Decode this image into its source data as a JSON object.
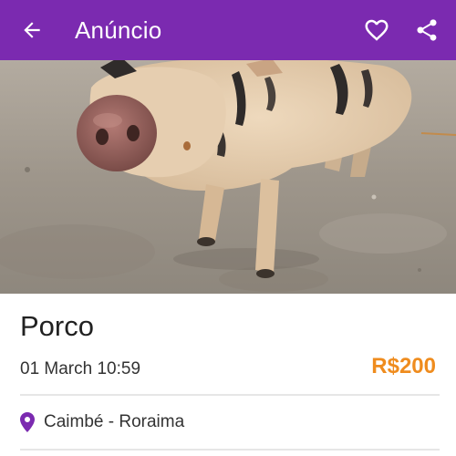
{
  "appbar": {
    "title": "Anúncio",
    "back_icon": "arrow-left-icon",
    "favorite_icon": "heart-outline-icon",
    "share_icon": "share-icon",
    "background_color": "#7b2ab0",
    "text_color": "#ffffff"
  },
  "photo": {
    "subject": "pig-photo"
  },
  "listing": {
    "title": "Porco",
    "date": "01 March 10:59",
    "price": "R$200",
    "price_color": "#ef8c1e",
    "location_icon": "map-pin-icon",
    "location": "Caimbé - Roraima",
    "location_icon_color": "#7b2ab0"
  }
}
